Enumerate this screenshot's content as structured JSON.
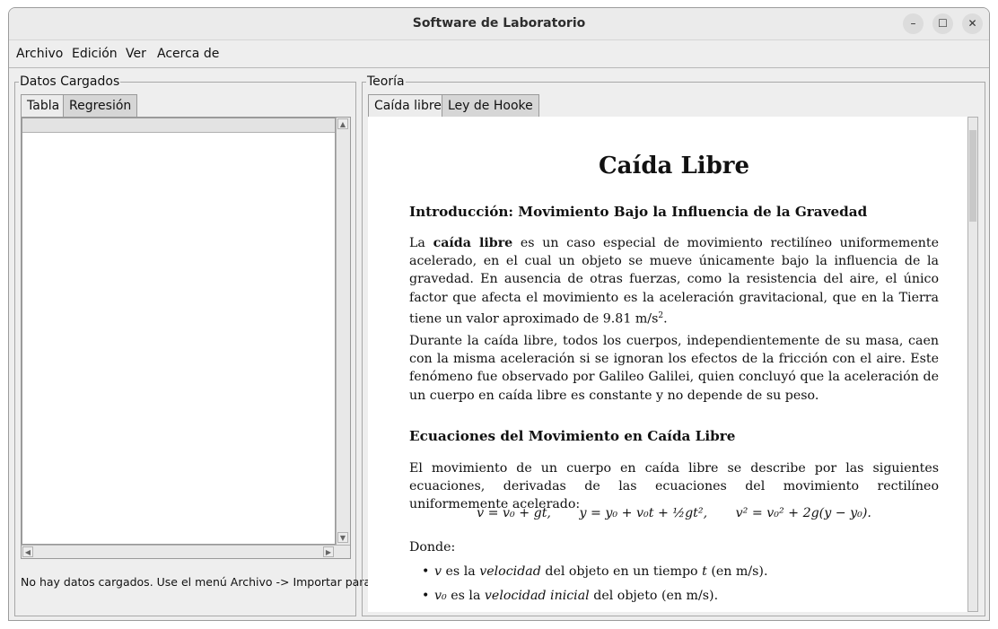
{
  "window": {
    "title": "Software de Laboratorio"
  },
  "window_controls": {
    "minimize": "–",
    "maximize": "☐",
    "close": "✕"
  },
  "menu": [
    "Archivo",
    "Edición",
    "Ver",
    "Acerca de"
  ],
  "left_panel": {
    "title": "Datos Cargados",
    "tabs": [
      "Tabla",
      "Regresión"
    ],
    "active_tab": "Tabla",
    "status": "No hay datos cargados. Use el menú Archivo -> Importar para"
  },
  "right_panel": {
    "title": "Teoría",
    "tabs": [
      "Caída libre",
      "Ley de Hooke"
    ],
    "active_tab": "Caída libre"
  },
  "document": {
    "title": "Caída Libre",
    "section1": "Introducción: Movimiento Bajo la Influencia de la Gravedad",
    "p1_a": "La",
    "p1_bold": "caída libre",
    "p1_b": "es un caso especial de movimiento rectilíneo uniformemente acelerado, en el cual un objeto se mueve únicamente bajo la influencia de la gravedad. En ausencia de otras fuerzas, como la resistencia del aire, el único factor que afecta el movimiento es la aceleración gravitacional, que en la Tierra tiene un valor aproximado de",
    "p1_value": "9.81 m/s",
    "p1_exp": "2",
    "p1_end": ".",
    "p2": "Durante la caída libre, todos los cuerpos, independientemente de su masa, caen con la misma aceleración si se ignoran los efectos de la fricción con el aire. Este fenómeno fue observado por Galileo Galilei, quien concluyó que la aceleración de un cuerpo en caída libre es constante y no depende de su peso.",
    "section2": "Ecuaciones del Movimiento en Caída Libre",
    "p3": "El movimiento de un cuerpo en caída libre se describe por las siguientes ecuaciones, derivadas de las ecuaciones del movimiento rectilíneo uniformemente acelerado:",
    "eq1": "v = v₀ + gt,",
    "eq2": "y = y₀ + v₀t + ½gt²,",
    "eq3": "v² = v₀² + 2g(y − y₀).",
    "donde": "Donde:",
    "b1_var": "v",
    "b1_a": "es la",
    "b1_em": "velocidad",
    "b1_b": "del objeto en un tiempo",
    "b1_t": "t",
    "b1_c": "(en m/s).",
    "b2_var": "v₀",
    "b2_a": "es la",
    "b2_em": "velocidad inicial",
    "b2_b": "del objeto (en m/s)."
  }
}
